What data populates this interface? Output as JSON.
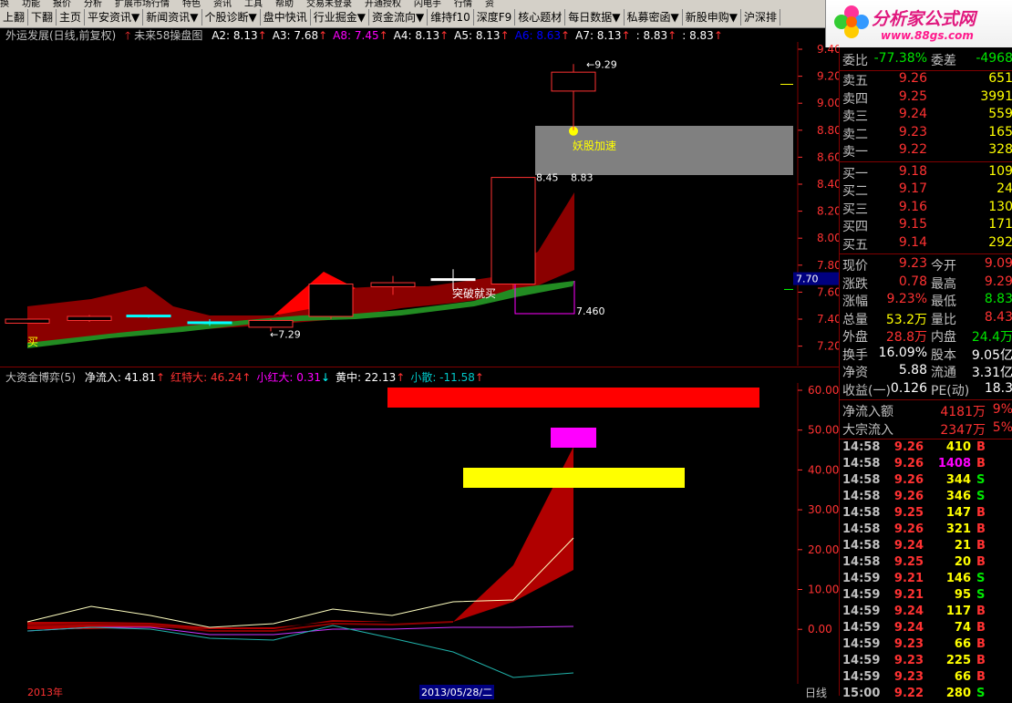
{
  "menubar": [
    "换",
    "功能",
    "报价",
    "分析",
    "扩展市场行情",
    "特色",
    "资讯",
    "工具",
    "帮助",
    "交易未登录",
    "开通授权",
    "闪电手",
    "行情",
    "资"
  ],
  "toolbar": [
    "上翻",
    "下翻",
    "主页",
    "平安资讯▼",
    "新闻资讯▼",
    "个股诊断▼",
    "盘中快讯",
    "行业掘金▼",
    "资金流向▼",
    "维持f10",
    "深度F9",
    "核心题材",
    "每日数据▼",
    "私募密函▼",
    "新股申购▼",
    "沪深排"
  ],
  "logo": {
    "title": "分析家公式网",
    "url": "www.88gs.com"
  },
  "chart_title": {
    "name": "外运发展(日线,前复权)",
    "indicator": "未来58操盘图",
    "items": [
      {
        "label": "A2: 8.13",
        "color": "#ffffff"
      },
      {
        "label": "A3: 7.68",
        "color": "#ffffff"
      },
      {
        "label": "A8: 7.45",
        "color": "#ff00ff"
      },
      {
        "label": "A4: 8.13",
        "color": "#ffffff"
      },
      {
        "label": "A5: 8.13",
        "color": "#ffffff"
      },
      {
        "label": "A6: 8.63",
        "color": "#0000ff"
      },
      {
        "label": "A7: 8.13",
        "color": "#ffffff"
      },
      {
        "label": ": 8.83",
        "color": "#ffffff"
      },
      {
        "label": ": 8.83",
        "color": "#ffffff"
      }
    ]
  },
  "sub_title": {
    "name": "大资金博弈(5)",
    "items": [
      {
        "label": "净流入: 41.81",
        "color": "#ffffff"
      },
      {
        "label": "红特大: 46.24",
        "color": "#ff3232"
      },
      {
        "label": "小红大: 0.31",
        "color": "#ff00ff"
      },
      {
        "label": "黄中: 22.13",
        "color": "#ffffff"
      },
      {
        "label": "小散: -11.58",
        "color": "#00c8c8"
      }
    ]
  },
  "main_axis": [
    "9.40",
    "9.20",
    "9.00",
    "8.80",
    "8.60",
    "8.40",
    "8.20",
    "8.00",
    "7.80",
    "7.60",
    "7.40",
    "7.20"
  ],
  "sub_axis": [
    "60.00",
    "50.00",
    "40.00",
    "30.00",
    "20.00",
    "10.00",
    "0.00"
  ],
  "price_tag": "7.70",
  "chart_labels": {
    "high": "9.29",
    "mid": "8.45",
    "mid2": "8.83",
    "low_right": "7.460",
    "low_left": "7.29",
    "buy": "买",
    "breakout": "突破就买",
    "yaogu": "妖股加速"
  },
  "bottom_labels": {
    "year": "2013年",
    "date": "2013/05/28/二",
    "period": "日线"
  },
  "quote": {
    "weibi_label": "委比",
    "weibi": "-77.38%",
    "weicha_label": "委差",
    "weicha": "-4968",
    "sells": [
      {
        "label": "卖五",
        "price": "9.26",
        "vol": "651"
      },
      {
        "label": "卖四",
        "price": "9.25",
        "vol": "3991"
      },
      {
        "label": "卖三",
        "price": "9.24",
        "vol": "559"
      },
      {
        "label": "卖二",
        "price": "9.23",
        "vol": "165"
      },
      {
        "label": "卖一",
        "price": "9.22",
        "vol": "328"
      }
    ],
    "buys": [
      {
        "label": "买一",
        "price": "9.18",
        "vol": "109"
      },
      {
        "label": "买二",
        "price": "9.17",
        "vol": "24"
      },
      {
        "label": "买三",
        "price": "9.16",
        "vol": "130"
      },
      {
        "label": "买四",
        "price": "9.15",
        "vol": "171"
      },
      {
        "label": "买五",
        "price": "9.14",
        "vol": "292"
      }
    ],
    "stats": [
      {
        "l1": "现价",
        "v1": "9.23",
        "l2": "今开",
        "v2": "9.09"
      },
      {
        "l1": "涨跌",
        "v1": "0.78",
        "l2": "最高",
        "v2": "9.29"
      },
      {
        "l1": "涨幅",
        "v1": "9.23%",
        "l2": "最低",
        "v2": "8.83"
      },
      {
        "l1": "总量",
        "v1": "53.2万",
        "l2": "量比",
        "v2": "8.43"
      },
      {
        "l1": "外盘",
        "v1": "28.8万",
        "l2": "内盘",
        "v2": "24.4万"
      },
      {
        "l1": "换手",
        "v1": "16.09%",
        "l2": "股本",
        "v2": "9.05亿"
      },
      {
        "l1": "净资",
        "v1": "5.88",
        "l2": "流通",
        "v2": "3.31亿"
      },
      {
        "l1": "收益(一)",
        "v1": "0.126",
        "l2": "PE(动)",
        "v2": "18.3"
      }
    ],
    "flow": [
      {
        "label": "净流入额",
        "value": "4181万",
        "pct": "9%"
      },
      {
        "label": "大宗流入",
        "value": "2347万",
        "pct": "5%"
      }
    ],
    "ticks": [
      {
        "t": "14:58",
        "p": "9.26",
        "v": "410",
        "d": "B"
      },
      {
        "t": "14:58",
        "p": "9.26",
        "v": "1408",
        "d": "B"
      },
      {
        "t": "14:58",
        "p": "9.26",
        "v": "344",
        "d": "S"
      },
      {
        "t": "14:58",
        "p": "9.26",
        "v": "346",
        "d": "S"
      },
      {
        "t": "14:58",
        "p": "9.25",
        "v": "147",
        "d": "B"
      },
      {
        "t": "14:58",
        "p": "9.26",
        "v": "321",
        "d": "B"
      },
      {
        "t": "14:58",
        "p": "9.24",
        "v": "21",
        "d": "B"
      },
      {
        "t": "14:58",
        "p": "9.25",
        "v": "20",
        "d": "B"
      },
      {
        "t": "14:59",
        "p": "9.21",
        "v": "146",
        "d": "S"
      },
      {
        "t": "14:59",
        "p": "9.21",
        "v": "95",
        "d": "S"
      },
      {
        "t": "14:59",
        "p": "9.24",
        "v": "117",
        "d": "B"
      },
      {
        "t": "14:59",
        "p": "9.24",
        "v": "74",
        "d": "B"
      },
      {
        "t": "14:59",
        "p": "9.23",
        "v": "66",
        "d": "B"
      },
      {
        "t": "14:59",
        "p": "9.23",
        "v": "225",
        "d": "B"
      },
      {
        "t": "14:59",
        "p": "9.23",
        "v": "66",
        "d": "B"
      },
      {
        "t": "15:00",
        "p": "9.22",
        "v": "280",
        "d": "S"
      }
    ]
  },
  "colors": {
    "up": "#ff3232",
    "down": "#00e600",
    "bg": "#000000",
    "border": "#800000"
  }
}
